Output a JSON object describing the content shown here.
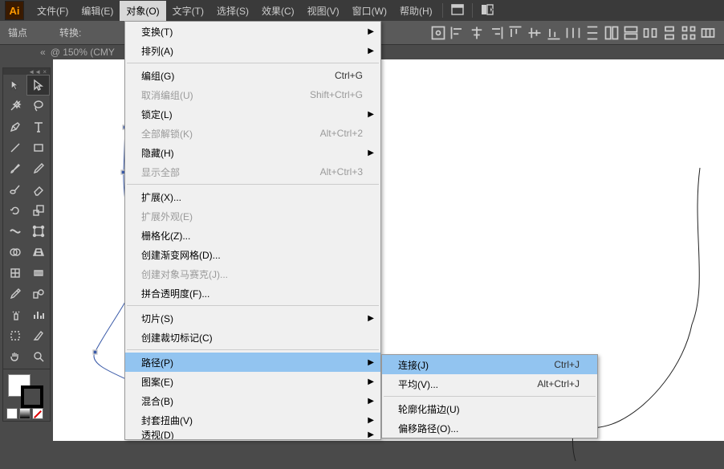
{
  "app": {
    "icon_label": "Ai"
  },
  "menubar": {
    "items": [
      {
        "label": "文件(F)"
      },
      {
        "label": "编辑(E)"
      },
      {
        "label": "对象(O)"
      },
      {
        "label": "文字(T)"
      },
      {
        "label": "选择(S)"
      },
      {
        "label": "效果(C)"
      },
      {
        "label": "视图(V)"
      },
      {
        "label": "窗口(W)"
      },
      {
        "label": "帮助(H)"
      }
    ]
  },
  "controlbar": {
    "anchor_label": "锚点",
    "convert_label": "转换:"
  },
  "tab": {
    "close_glyph": "«",
    "title": "@ 150% (CMY"
  },
  "object_menu": {
    "groups": [
      [
        {
          "label": "变换(T)",
          "sub": true
        },
        {
          "label": "排列(A)",
          "sub": true
        }
      ],
      [
        {
          "label": "编组(G)",
          "shortcut": "Ctrl+G"
        },
        {
          "label": "取消编组(U)",
          "shortcut": "Shift+Ctrl+G",
          "disabled": true
        },
        {
          "label": "锁定(L)",
          "sub": true
        },
        {
          "label": "全部解锁(K)",
          "shortcut": "Alt+Ctrl+2",
          "disabled": true
        },
        {
          "label": "隐藏(H)",
          "sub": true
        },
        {
          "label": "显示全部",
          "shortcut": "Alt+Ctrl+3",
          "disabled": true
        }
      ],
      [
        {
          "label": "扩展(X)..."
        },
        {
          "label": "扩展外观(E)",
          "disabled": true
        },
        {
          "label": "栅格化(Z)..."
        },
        {
          "label": "创建渐变网格(D)..."
        },
        {
          "label": "创建对象马赛克(J)...",
          "disabled": true
        },
        {
          "label": "拼合透明度(F)..."
        }
      ],
      [
        {
          "label": "切片(S)",
          "sub": true
        },
        {
          "label": "创建裁切标记(C)"
        }
      ],
      [
        {
          "label": "路径(P)",
          "sub": true,
          "highlight": true
        },
        {
          "label": "图案(E)",
          "sub": true
        },
        {
          "label": "混合(B)",
          "sub": true
        },
        {
          "label": "封套扭曲(V)",
          "sub": true
        },
        {
          "label": "透视(D)",
          "sub": true,
          "cut": true
        }
      ]
    ]
  },
  "path_submenu": {
    "groups": [
      [
        {
          "label": "连接(J)",
          "shortcut": "Ctrl+J",
          "highlight": true
        },
        {
          "label": "平均(V)...",
          "shortcut": "Alt+Ctrl+J"
        }
      ],
      [
        {
          "label": "轮廓化描边(U)"
        },
        {
          "label": "偏移路径(O)..."
        }
      ]
    ]
  },
  "toolbox": {
    "collapse_glyph": "◄◄ ×"
  }
}
